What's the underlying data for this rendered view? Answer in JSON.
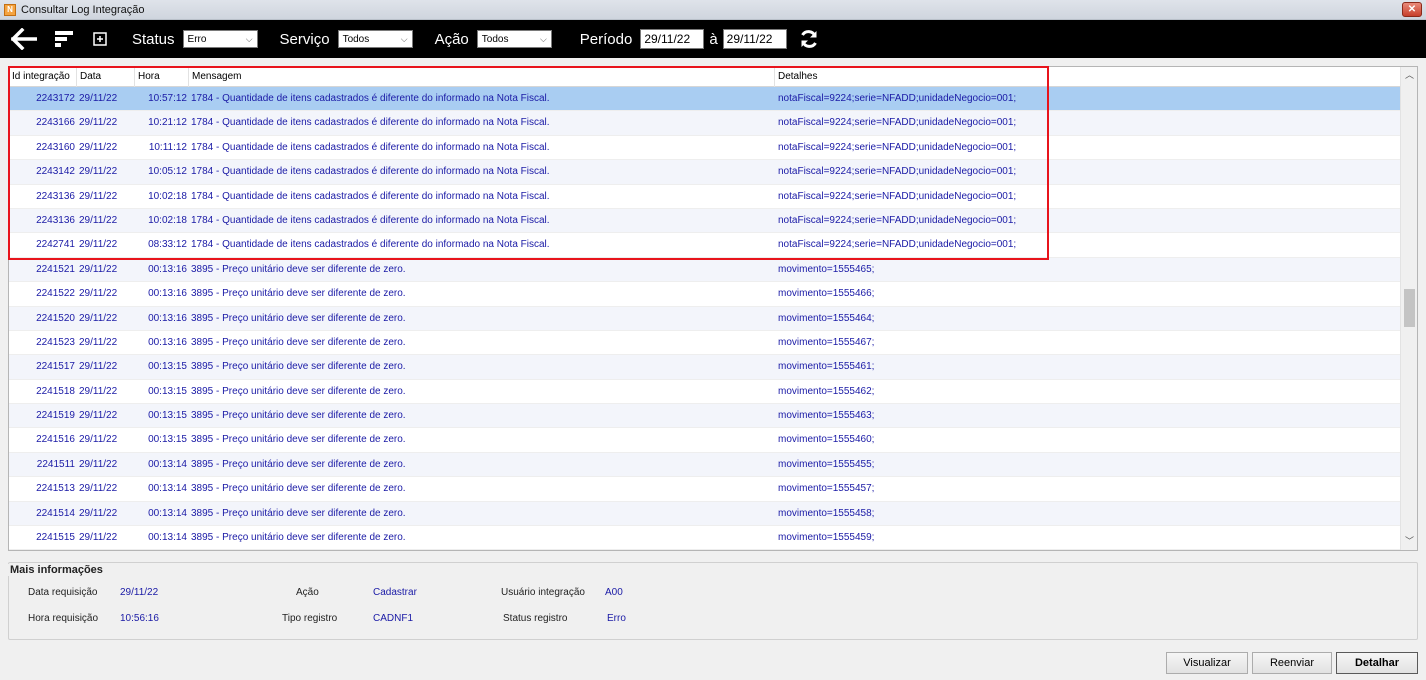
{
  "window": {
    "title": "Consultar Log Integração",
    "icon_letter": "N"
  },
  "toolbar": {
    "status_label": "Status",
    "status_value": "Erro",
    "servico_label": "Serviço",
    "servico_value": "Todos",
    "acao_label": "Ação",
    "acao_value": "Todos",
    "periodo_label": "Período",
    "date_from": "29/11/22",
    "a_label": "à",
    "date_to": "29/11/22",
    "icons": [
      "arrow-left-icon",
      "filter-icon",
      "expand-icon",
      "refresh-icon"
    ]
  },
  "grid": {
    "columns": [
      "Id integração",
      "Data",
      "Hora",
      "Mensagem",
      "Detalhes"
    ],
    "rows": [
      {
        "id": "2243172",
        "data": "29/11/22",
        "hora": "10:57:12",
        "msg": "1784 - Quantidade de itens cadastrados é diferente do informado na Nota Fiscal.",
        "det": "notaFiscal=9224;serie=NFADD;unidadeNegocio=001;"
      },
      {
        "id": "2243166",
        "data": "29/11/22",
        "hora": "10:21:12",
        "msg": "1784 - Quantidade de itens cadastrados é diferente do informado na Nota Fiscal.",
        "det": "notaFiscal=9224;serie=NFADD;unidadeNegocio=001;"
      },
      {
        "id": "2243160",
        "data": "29/11/22",
        "hora": "10:11:12",
        "msg": "1784 - Quantidade de itens cadastrados é diferente do informado na Nota Fiscal.",
        "det": "notaFiscal=9224;serie=NFADD;unidadeNegocio=001;"
      },
      {
        "id": "2243142",
        "data": "29/11/22",
        "hora": "10:05:12",
        "msg": "1784 - Quantidade de itens cadastrados é diferente do informado na Nota Fiscal.",
        "det": "notaFiscal=9224;serie=NFADD;unidadeNegocio=001;"
      },
      {
        "id": "2243136",
        "data": "29/11/22",
        "hora": "10:02:18",
        "msg": "1784 - Quantidade de itens cadastrados é diferente do informado na Nota Fiscal.",
        "det": "notaFiscal=9224;serie=NFADD;unidadeNegocio=001;"
      },
      {
        "id": "2243136",
        "data": "29/11/22",
        "hora": "10:02:18",
        "msg": "1784 - Quantidade de itens cadastrados é diferente do informado na Nota Fiscal.",
        "det": "notaFiscal=9224;serie=NFADD;unidadeNegocio=001;"
      },
      {
        "id": "2242741",
        "data": "29/11/22",
        "hora": "08:33:12",
        "msg": "1784 - Quantidade de itens cadastrados é diferente do informado na Nota Fiscal.",
        "det": "notaFiscal=9224;serie=NFADD;unidadeNegocio=001;"
      },
      {
        "id": "2241521",
        "data": "29/11/22",
        "hora": "00:13:16",
        "msg": "3895 - Preço unitário deve ser diferente de zero.",
        "det": "movimento=1555465;"
      },
      {
        "id": "2241522",
        "data": "29/11/22",
        "hora": "00:13:16",
        "msg": "3895 - Preço unitário deve ser diferente de zero.",
        "det": "movimento=1555466;"
      },
      {
        "id": "2241520",
        "data": "29/11/22",
        "hora": "00:13:16",
        "msg": "3895 - Preço unitário deve ser diferente de zero.",
        "det": "movimento=1555464;"
      },
      {
        "id": "2241523",
        "data": "29/11/22",
        "hora": "00:13:16",
        "msg": "3895 - Preço unitário deve ser diferente de zero.",
        "det": "movimento=1555467;"
      },
      {
        "id": "2241517",
        "data": "29/11/22",
        "hora": "00:13:15",
        "msg": "3895 - Preço unitário deve ser diferente de zero.",
        "det": "movimento=1555461;"
      },
      {
        "id": "2241518",
        "data": "29/11/22",
        "hora": "00:13:15",
        "msg": "3895 - Preço unitário deve ser diferente de zero.",
        "det": "movimento=1555462;"
      },
      {
        "id": "2241519",
        "data": "29/11/22",
        "hora": "00:13:15",
        "msg": "3895 - Preço unitário deve ser diferente de zero.",
        "det": "movimento=1555463;"
      },
      {
        "id": "2241516",
        "data": "29/11/22",
        "hora": "00:13:15",
        "msg": "3895 - Preço unitário deve ser diferente de zero.",
        "det": "movimento=1555460;"
      },
      {
        "id": "2241511",
        "data": "29/11/22",
        "hora": "00:13:14",
        "msg": "3895 - Preço unitário deve ser diferente de zero.",
        "det": "movimento=1555455;"
      },
      {
        "id": "2241513",
        "data": "29/11/22",
        "hora": "00:13:14",
        "msg": "3895 - Preço unitário deve ser diferente de zero.",
        "det": "movimento=1555457;"
      },
      {
        "id": "2241514",
        "data": "29/11/22",
        "hora": "00:13:14",
        "msg": "3895 - Preço unitário deve ser diferente de zero.",
        "det": "movimento=1555458;"
      },
      {
        "id": "2241515",
        "data": "29/11/22",
        "hora": "00:13:14",
        "msg": "3895 - Preço unitário deve ser diferente de zero.",
        "det": "movimento=1555459;"
      }
    ],
    "selected_index": 0,
    "highlight_color": "#e8141c",
    "text_color": "#1a1aa6"
  },
  "info": {
    "title": "Mais informações",
    "data_requisicao_label": "Data requisição",
    "data_requisicao_value": "29/11/22",
    "hora_requisicao_label": "Hora requisição",
    "hora_requisicao_value": "10:56:16",
    "acao_label": "Ação",
    "acao_value": "Cadastrar",
    "tipo_registro_label": "Tipo registro",
    "tipo_registro_value": "CADNF1",
    "usuario_label": "Usuário integração",
    "usuario_value": "A00",
    "status_registro_label": "Status registro",
    "status_registro_value": "Erro"
  },
  "buttons": {
    "visualizar": "Visualizar",
    "reenviar": "Reenviar",
    "detalhar": "Detalhar"
  }
}
